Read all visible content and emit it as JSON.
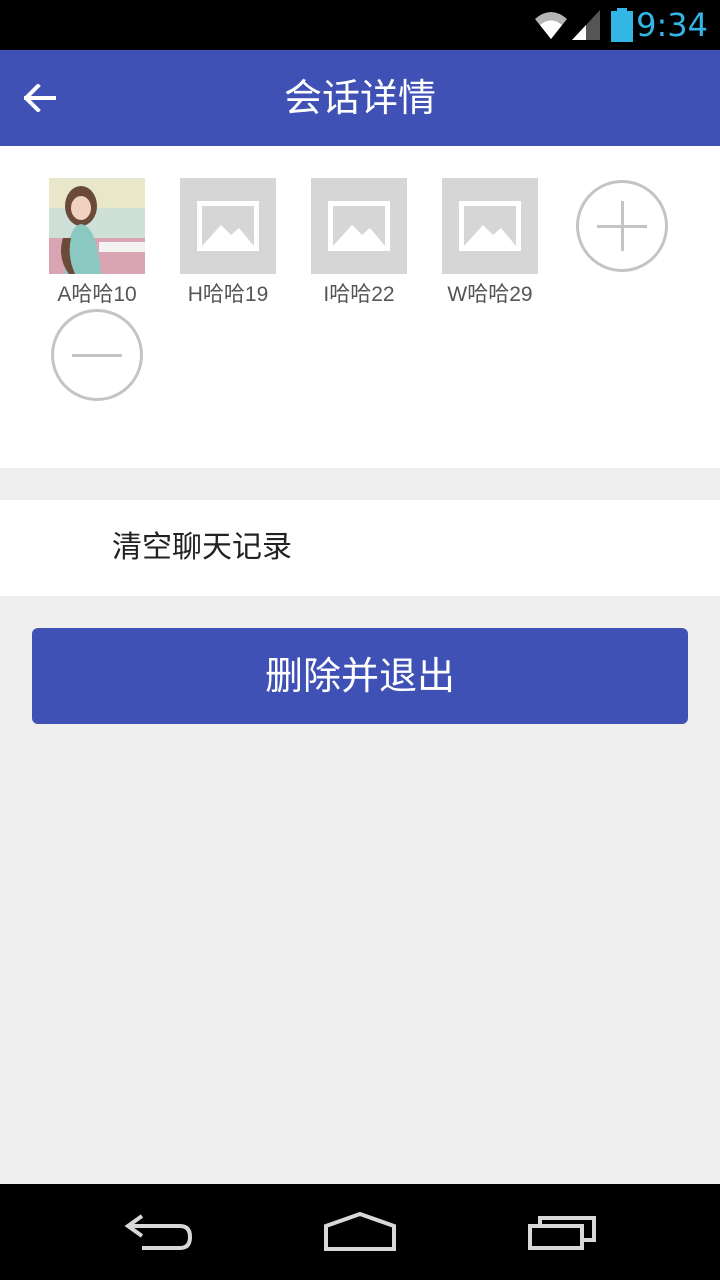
{
  "status_bar": {
    "time": "9:34",
    "accent_color": "#33b5e5",
    "icons": [
      "wifi-icon",
      "signal-icon",
      "battery-icon"
    ]
  },
  "header": {
    "title": "会话详情",
    "back_icon": "arrow-left-icon",
    "background": "#3f51b5"
  },
  "members": [
    {
      "name": "A哈哈10",
      "avatar": "photo"
    },
    {
      "name": "H哈哈19",
      "avatar": "image-placeholder-icon"
    },
    {
      "name": "I哈哈22",
      "avatar": "image-placeholder-icon"
    },
    {
      "name": "W哈哈29",
      "avatar": "image-placeholder-icon"
    }
  ],
  "member_actions": {
    "add_icon": "plus-circle-icon",
    "remove_icon": "minus-circle-icon"
  },
  "settings": {
    "clear_history_label": "清空聊天记录"
  },
  "actions": {
    "delete_exit_label": "删除并退出"
  },
  "nav_bar": {
    "icons": [
      "back-icon",
      "home-icon",
      "recents-icon"
    ]
  }
}
